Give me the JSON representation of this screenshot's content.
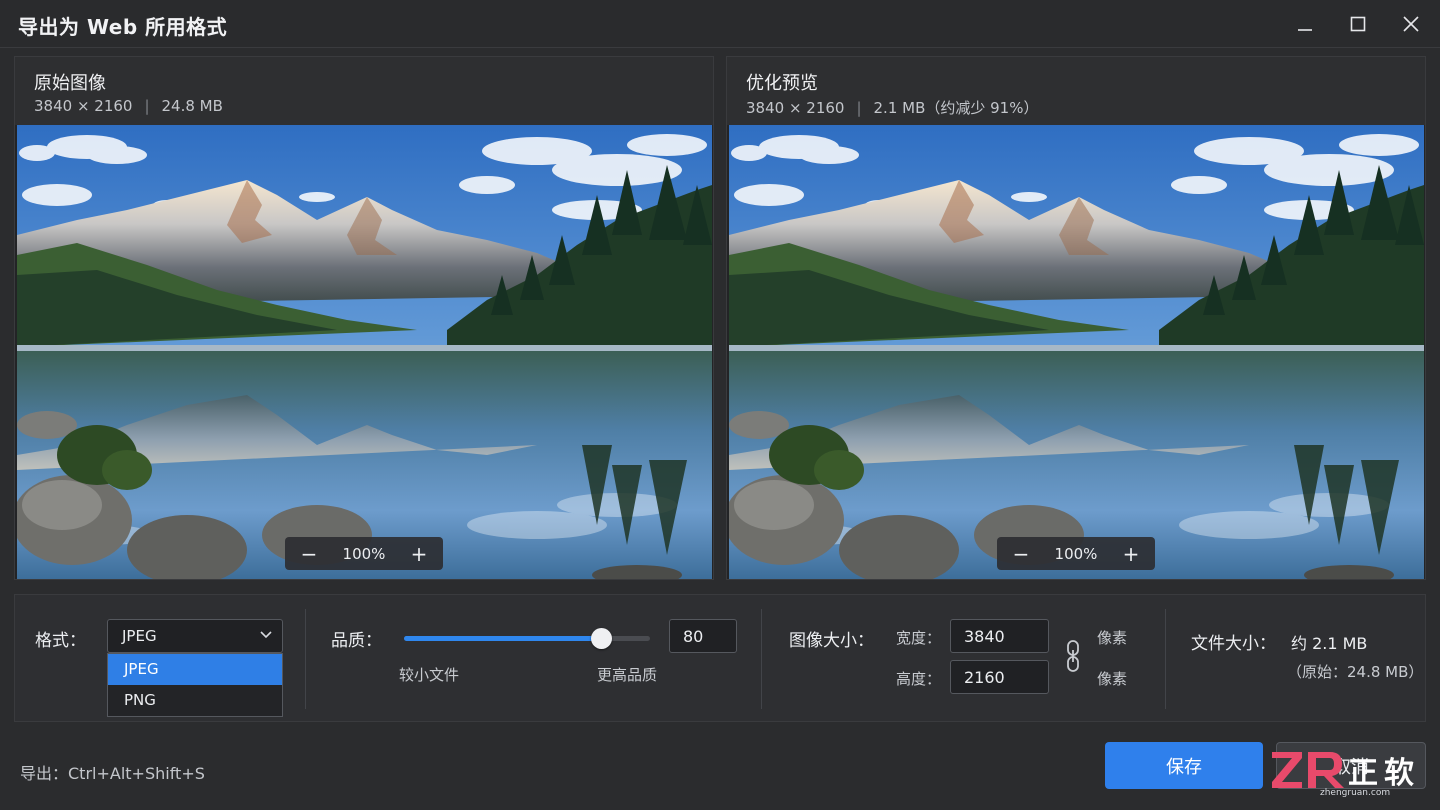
{
  "window": {
    "title": "导出为 Web 所用格式",
    "controls": [
      "minimize-icon",
      "maximize-icon",
      "close-icon"
    ]
  },
  "original": {
    "title": "原始图像",
    "dimensions": "3840 × 2160",
    "separator": "|",
    "size": "24.8 MB",
    "zoom": "100%"
  },
  "preview": {
    "title": "优化预览",
    "dimensions": "3840 × 2160",
    "separator": "|",
    "size": "2.1 MB（约减少 91%）",
    "zoom": "100%"
  },
  "zoom_controls": {
    "minus": "−",
    "plus": "+"
  },
  "format": {
    "label": "格式：",
    "selected": "JPEG",
    "options": [
      "JPEG",
      "PNG"
    ]
  },
  "quality": {
    "label": "品质：",
    "value": "80",
    "level": 0.8,
    "min_label": "较小文件",
    "max_label": "更高品质"
  },
  "image_size": {
    "label": "图像大小：",
    "width_label": "宽度：",
    "width": "3840",
    "height_label": "高度：",
    "height": "2160",
    "unit": "像素"
  },
  "file_size": {
    "label": "文件大小：",
    "value": "约 2.1 MB",
    "original": "（原始：24.8 MB）"
  },
  "footer": {
    "hint": "导出：Ctrl+Alt+Shift+S",
    "save": "保存",
    "cancel": "取消"
  },
  "watermark": {
    "brand": "正软",
    "url": "zhengruan.com"
  },
  "colors": {
    "accent": "#2f80ec",
    "background": "#2b2c2e"
  }
}
